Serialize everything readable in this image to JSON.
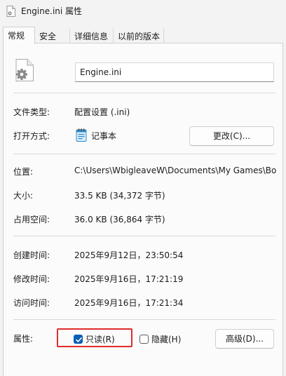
{
  "window": {
    "title": "Engine.ini 属性"
  },
  "tabs": [
    {
      "label": "常规",
      "active": true
    },
    {
      "label": "安全",
      "active": false
    },
    {
      "label": "详细信息",
      "active": false
    },
    {
      "label": "以前的版本",
      "active": false
    }
  ],
  "general": {
    "filename": "Engine.ini",
    "file_type_label": "文件类型:",
    "file_type_value": "配置设置 (.ini)",
    "opens_with_label": "打开方式:",
    "opens_with_value": "记事本",
    "change_button": "更改(C)...",
    "location_label": "位置:",
    "location_value": "C:\\Users\\WbigleaveW\\Documents\\My Games\\Bo",
    "size_label": "大小:",
    "size_value": "33.5 KB (34,372 字节)",
    "size_on_disk_label": "占用空间:",
    "size_on_disk_value": "36.0 KB (36,864 字节)",
    "created_label": "创建时间:",
    "created_value": "2025年9月12日，23:50:54",
    "modified_label": "修改时间:",
    "modified_value": "2025年9月16日，17:21:19",
    "accessed_label": "访问时间:",
    "accessed_value": "2025年9月16日，17:21:34",
    "attributes_label": "属性:",
    "readonly_label": "只读(R)",
    "readonly_checked": true,
    "hidden_label": "隐藏(H)",
    "hidden_checked": false,
    "advanced_button": "高级(D)..."
  },
  "icons": {
    "title": "file-settings-icon",
    "file": "file-settings-icon",
    "notepad": "notepad-icon",
    "check": "checkmark-icon"
  },
  "colors": {
    "checkbox_accent": "#0a5fb4",
    "highlight_box": "#e02b2b"
  }
}
